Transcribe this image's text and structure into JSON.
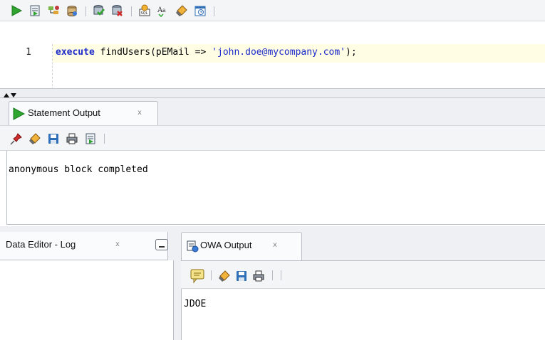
{
  "editor": {
    "line_number": "1",
    "code_keyword": "execute",
    "code_call": " findUsers(pEMail => ",
    "code_string": "'john.doe@mycompany.com'",
    "code_end": ");"
  },
  "statement_output": {
    "tab_label": "Statement Output",
    "close_glyph": "x",
    "text": "anonymous block completed"
  },
  "data_editor_log": {
    "tab_label": "Data Editor - Log",
    "close_glyph": "x"
  },
  "owa_output": {
    "tab_label": "OWA Output",
    "close_glyph": "x",
    "text": "JDOE"
  },
  "icons": {
    "worksheet_toolbar": [
      "run-statement-icon",
      "run-script-icon",
      "explain-plan-icon",
      "autotrace-icon",
      "commit-icon",
      "rollback-icon",
      "sql-tuning-advisor-icon",
      "format-case-icon",
      "clear-icon",
      "sql-history-icon"
    ],
    "statement_toolbar": [
      "pin-icon",
      "clear-icon",
      "save-icon",
      "print-icon",
      "open-in-editor-icon"
    ],
    "owa_toolbar": [
      "enable-output-icon",
      "clear-icon",
      "save-icon",
      "print-icon"
    ]
  },
  "colors": {
    "run_green": "#2fa530",
    "keyword_blue": "#1b2ac9",
    "current_line": "#fffde4"
  }
}
